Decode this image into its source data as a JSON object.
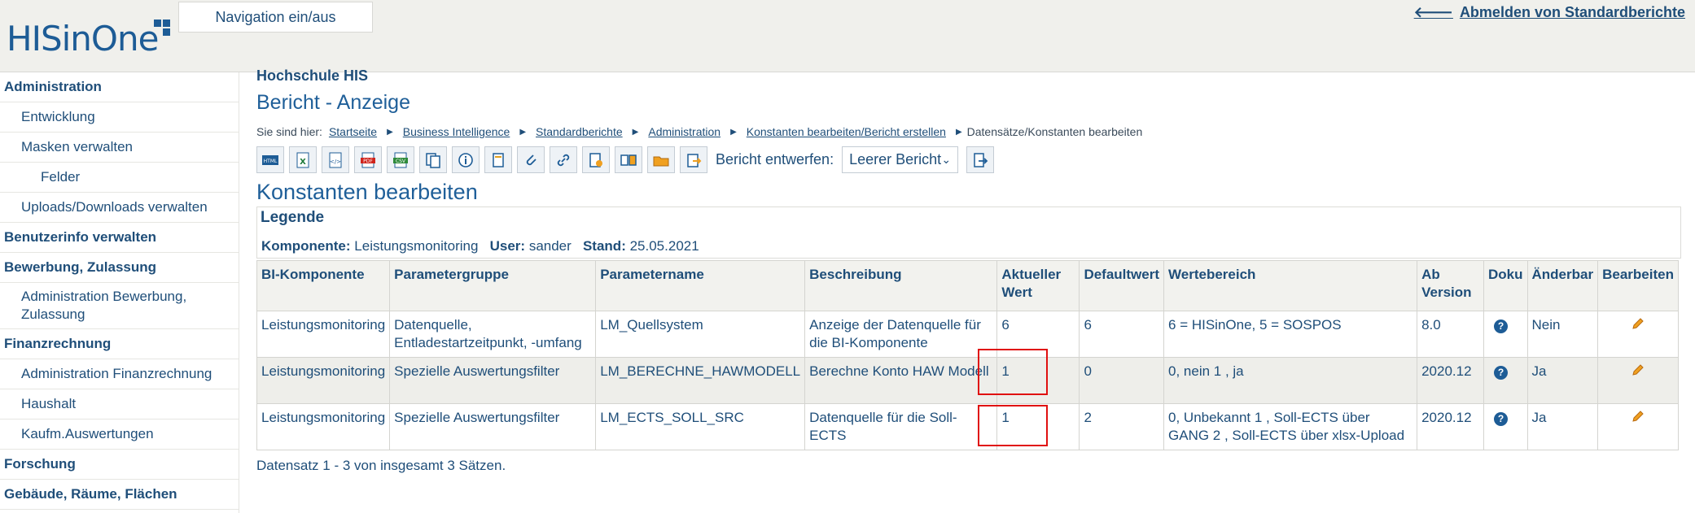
{
  "header": {
    "logo_text": "HISinOne",
    "nav_toggle_label": "Navigation ein/aus",
    "logout_label": "Abmelden von Standardberichte"
  },
  "sidebar": {
    "items": [
      {
        "label": "Administration",
        "level": 0
      },
      {
        "label": "Entwicklung",
        "level": 1
      },
      {
        "label": "Masken verwalten",
        "level": 1
      },
      {
        "label": "Felder",
        "level": 2
      },
      {
        "label": "Uploads/Downloads verwalten",
        "level": 1
      },
      {
        "label": "Benutzerinfo verwalten",
        "level": 0
      },
      {
        "label": "Bewerbung, Zulassung",
        "level": 0
      },
      {
        "label": "Administration Bewerbung, Zulassung",
        "level": 1
      },
      {
        "label": "Finanzrechnung",
        "level": 0
      },
      {
        "label": "Administration Finanzrechnung",
        "level": 1
      },
      {
        "label": "Haushalt",
        "level": 1
      },
      {
        "label": "Kaufm.Auswertungen",
        "level": 1
      },
      {
        "label": "Forschung",
        "level": 0
      },
      {
        "label": "Gebäude, Räume, Flächen",
        "level": 0
      }
    ]
  },
  "main": {
    "org_name": "Hochschule HIS",
    "page_title": "Bericht - Anzeige",
    "breadcrumb": {
      "lead": "Sie sind hier:",
      "items": [
        "Startseite",
        "Business Intelligence",
        "Standardberichte",
        "Administration",
        "Konstanten bearbeiten/Bericht erstellen"
      ],
      "current": "Datensätze/Konstanten bearbeiten"
    },
    "toolbar": {
      "buttons": [
        "html-export-icon",
        "excel-export-icon",
        "xml-export-icon",
        "pdf-export-icon",
        "csv-export-icon",
        "copy-icon",
        "info-icon",
        "notepad-icon",
        "attachment-icon",
        "link-icon",
        "report-config-icon",
        "compare-icon",
        "folder-icon",
        "clipboard-export-icon"
      ],
      "design_label": "Bericht entwerfen:",
      "design_select_value": "Leerer Bericht"
    },
    "section_title": "Konstanten bearbeiten",
    "legend": {
      "title": "Legende",
      "komponente_label": "Komponente:",
      "komponente_value": "Leistungsmonitoring",
      "user_label": "User:",
      "user_value": "sander",
      "stand_label": "Stand:",
      "stand_value": "25.05.2021"
    },
    "table": {
      "columns": [
        "BI-Komponente",
        "Parametergruppe",
        "Parametername",
        "Beschreibung",
        "Aktueller Wert",
        "Defaultwert",
        "Wertebereich",
        "Ab Version",
        "Doku",
        "Änderbar",
        "Bearbeiten"
      ],
      "rows": [
        [
          "Leistungsmonitoring",
          "Datenquelle, Entladestartzeitpunkt, -umfang",
          "LM_Quellsystem",
          "Anzeige der Datenquelle für die BI-Komponente",
          "6",
          "6",
          "6 = HISinOne, 5 = SOSPOS",
          "8.0",
          "",
          "Nein",
          ""
        ],
        [
          "Leistungsmonitoring",
          "Spezielle Auswertungsfilter",
          "LM_BERECHNE_HAWMODELL",
          "Berechne Konto HAW Modell",
          "1",
          "0",
          "0, nein 1 , ja",
          "2020.12",
          "",
          "Ja",
          ""
        ],
        [
          "Leistungsmonitoring",
          "Spezielle Auswertungsfilter",
          "LM_ECTS_SOLL_SRC",
          "Datenquelle für die Soll-ECTS",
          "1",
          "2",
          "0, Unbekannt 1 , Soll-ECTS über GANG 2 , Soll-ECTS über xlsx-Upload",
          "2020.12",
          "",
          "Ja",
          ""
        ]
      ]
    },
    "footer_count": "Datensatz 1 - 3 von insgesamt 3 Sätzen."
  },
  "colors": {
    "brand": "#1d5c96",
    "highlight_box": "#e01010",
    "edit_icon": "#f0a020"
  }
}
